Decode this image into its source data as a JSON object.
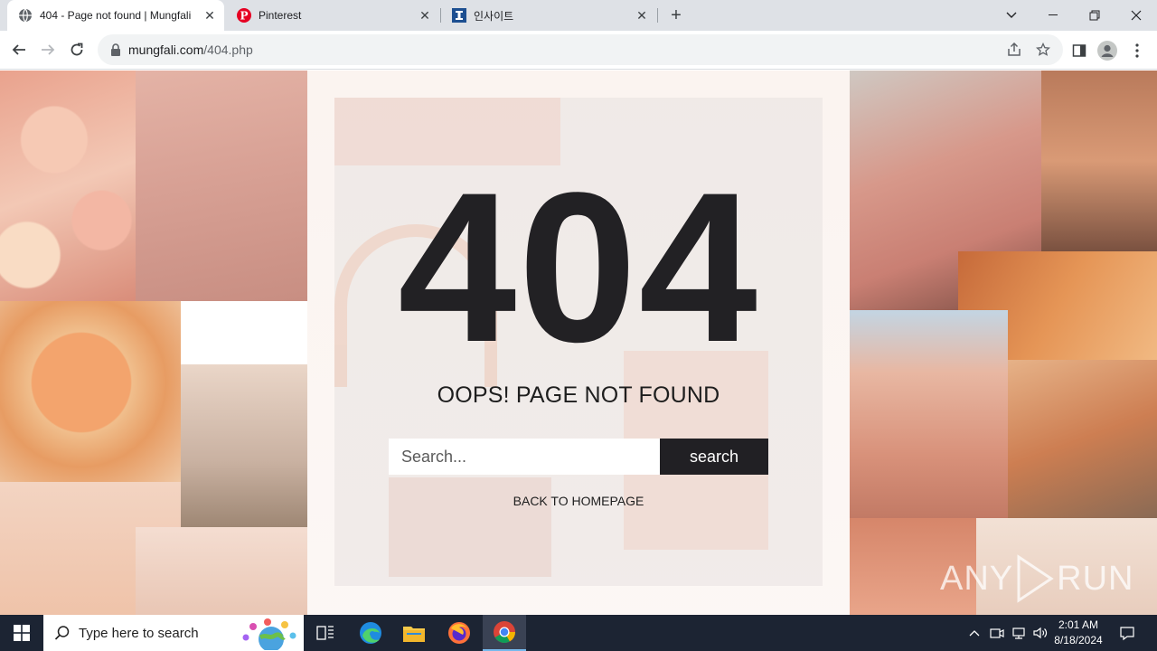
{
  "browser": {
    "tabs": [
      {
        "title": "404 - Page not found | Mungfali",
        "favicon": "globe-icon",
        "active": true
      },
      {
        "title": "Pinterest",
        "favicon": "pinterest-icon",
        "active": false
      },
      {
        "title": "인사이트",
        "favicon": "insight-icon",
        "active": false
      }
    ],
    "url_domain": "mungfali.com",
    "url_path": "/404.php"
  },
  "page": {
    "error_code": "404",
    "message": "OOPS! PAGE NOT FOUND",
    "search_placeholder": "Search...",
    "search_button": "search",
    "home_link": "BACK TO HOMEPAGE"
  },
  "watermark": {
    "left": "ANY",
    "right": "RUN"
  },
  "taskbar": {
    "search_placeholder": "Type here to search",
    "time": "2:01 AM",
    "date": "8/18/2024",
    "apps": [
      "task-view-icon",
      "edge-icon",
      "file-explorer-icon",
      "firefox-icon",
      "chrome-icon"
    ]
  },
  "colors": {
    "accent_dark": "#212024",
    "tab_strip": "#dee1e6",
    "taskbar": "#1c2433"
  }
}
